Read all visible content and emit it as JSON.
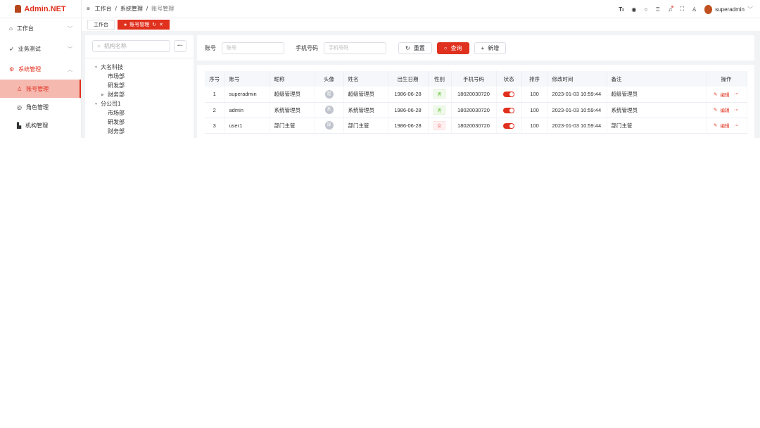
{
  "app": {
    "title": "Admin.NET"
  },
  "sidebar": {
    "items": [
      {
        "label": "工作台",
        "icon": "home-icon"
      },
      {
        "label": "业务测试",
        "icon": "send-icon"
      },
      {
        "label": "系统管理",
        "icon": "gear-icon"
      }
    ],
    "sub": [
      {
        "label": "账号管理"
      },
      {
        "label": "角色管理"
      },
      {
        "label": "机构管理"
      }
    ]
  },
  "breadcrumb": [
    "工作台",
    "系统管理",
    "账号管理"
  ],
  "user": {
    "name": "superadmin"
  },
  "tabs": [
    {
      "label": "工作台"
    },
    {
      "label": "账号管理"
    }
  ],
  "tree": {
    "search_placeholder": "机构名称",
    "more": "···",
    "nodes": [
      {
        "label": "大名科技"
      },
      {
        "label": "市场部"
      },
      {
        "label": "研发部"
      },
      {
        "label": "财务部"
      },
      {
        "label": "分公司1"
      },
      {
        "label": "市场部"
      },
      {
        "label": "研发部"
      },
      {
        "label": "财务部"
      }
    ]
  },
  "search": {
    "account_label": "账号",
    "account_placeholder": "账号",
    "phone_label": "手机号码",
    "phone_placeholder": "手机号码",
    "reset": "重置",
    "query": "查询",
    "add": "新增"
  },
  "table": {
    "headers": [
      "序号",
      "账号",
      "昵称",
      "头像",
      "姓名",
      "出生日期",
      "性别",
      "手机号码",
      "状态",
      "排序",
      "修改时间",
      "备注",
      "操作"
    ],
    "edit": "编辑",
    "more": "···",
    "rows": [
      {
        "no": "1",
        "account": "superadmin",
        "nick": "超级管理员",
        "avatar": "超",
        "name": "超级管理员",
        "birth": "1986-06-28",
        "sex": "男",
        "phone": "18020030720",
        "status": true,
        "order": "100",
        "time": "2023-01-03 10:59:44",
        "remark": "超级管理员"
      },
      {
        "no": "2",
        "account": "admin",
        "nick": "系统管理员",
        "avatar": "系",
        "name": "系统管理员",
        "birth": "1986-06-28",
        "sex": "男",
        "phone": "18020030720",
        "status": true,
        "order": "100",
        "time": "2023-01-03 10:59:44",
        "remark": "系统管理员"
      },
      {
        "no": "3",
        "account": "user1",
        "nick": "部门主管",
        "avatar": "部",
        "name": "部门主管",
        "birth": "1986-06-28",
        "sex": "女",
        "phone": "18020030720",
        "status": true,
        "order": "100",
        "time": "2023-01-03 10:59:44",
        "remark": "部门主管"
      }
    ]
  },
  "colors": {
    "accent": "#e0301e"
  }
}
